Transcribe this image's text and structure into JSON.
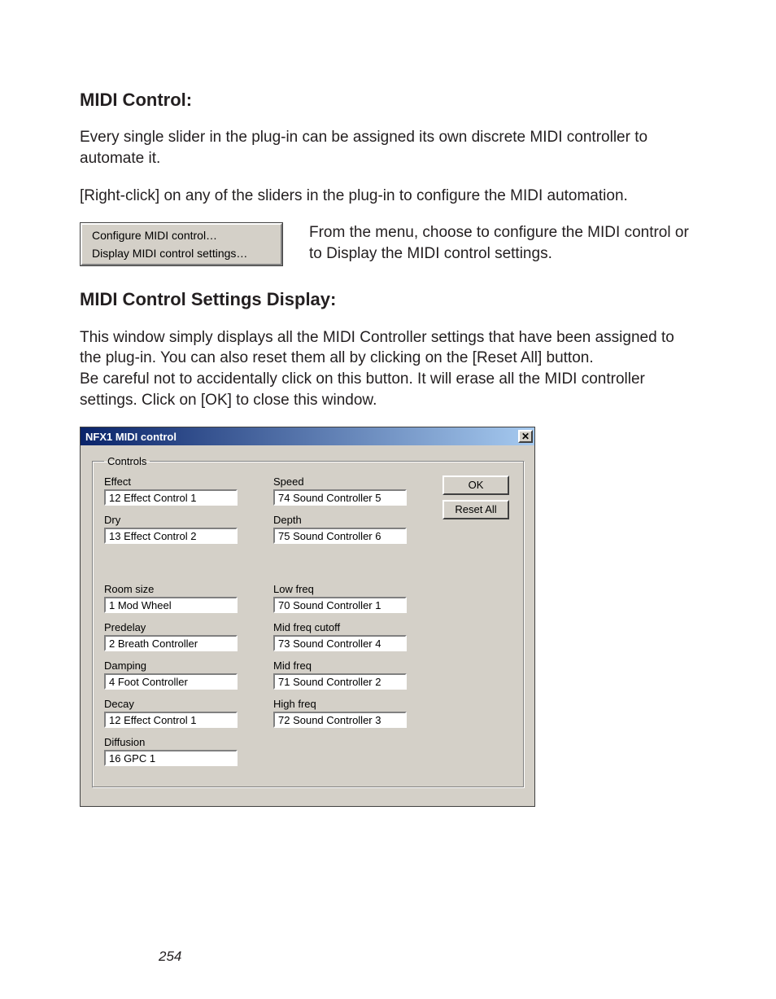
{
  "heading1": "MIDI Control:",
  "para1": "Every single slider in the plug-in can be assigned its own discrete MIDI controller to automate it.",
  "para2": "[Right-click] on any of the sliders in the plug-in to configure the MIDI automation.",
  "context_menu": {
    "item1": "Configure MIDI control…",
    "item2": "Display MIDI control settings…"
  },
  "menu_caption": "From the menu, choose to configure the MIDI control or to Display the MIDI control settings.",
  "heading2": "MIDI Control Settings Display:",
  "para3": "This window simply displays all the MIDI Controller settings that have been assigned to the plug-in.  You can also reset them all by clicking on the [Reset All] button.",
  "para4": "Be careful not to accidentally click on this button.  It will erase all the MIDI controller settings.  Click on [OK] to close this window.",
  "dialog": {
    "title": "NFX1 MIDI control",
    "close_glyph": "✕",
    "group_label": "Controls",
    "ok_label": "OK",
    "reset_label": "Reset All",
    "left": [
      {
        "label": "Effect",
        "value": "12 Effect Control 1"
      },
      {
        "label": "Dry",
        "value": "13 Effect Control 2"
      },
      {
        "label": "Room size",
        "value": "1 Mod Wheel"
      },
      {
        "label": "Predelay",
        "value": "2 Breath Controller"
      },
      {
        "label": "Damping",
        "value": "4 Foot Controller"
      },
      {
        "label": "Decay",
        "value": "12 Effect Control 1"
      },
      {
        "label": "Diffusion",
        "value": "16 GPC 1"
      }
    ],
    "right": [
      {
        "label": "Speed",
        "value": "74 Sound Controller 5"
      },
      {
        "label": "Depth",
        "value": "75 Sound Controller 6"
      },
      {
        "label": "Low freq",
        "value": "70 Sound Controller 1"
      },
      {
        "label": "Mid freq cutoff",
        "value": "73 Sound Controller 4"
      },
      {
        "label": "Mid freq",
        "value": "71 Sound Controller 2"
      },
      {
        "label": "High freq",
        "value": "72 Sound Controller 3"
      }
    ]
  },
  "page_number": "254"
}
